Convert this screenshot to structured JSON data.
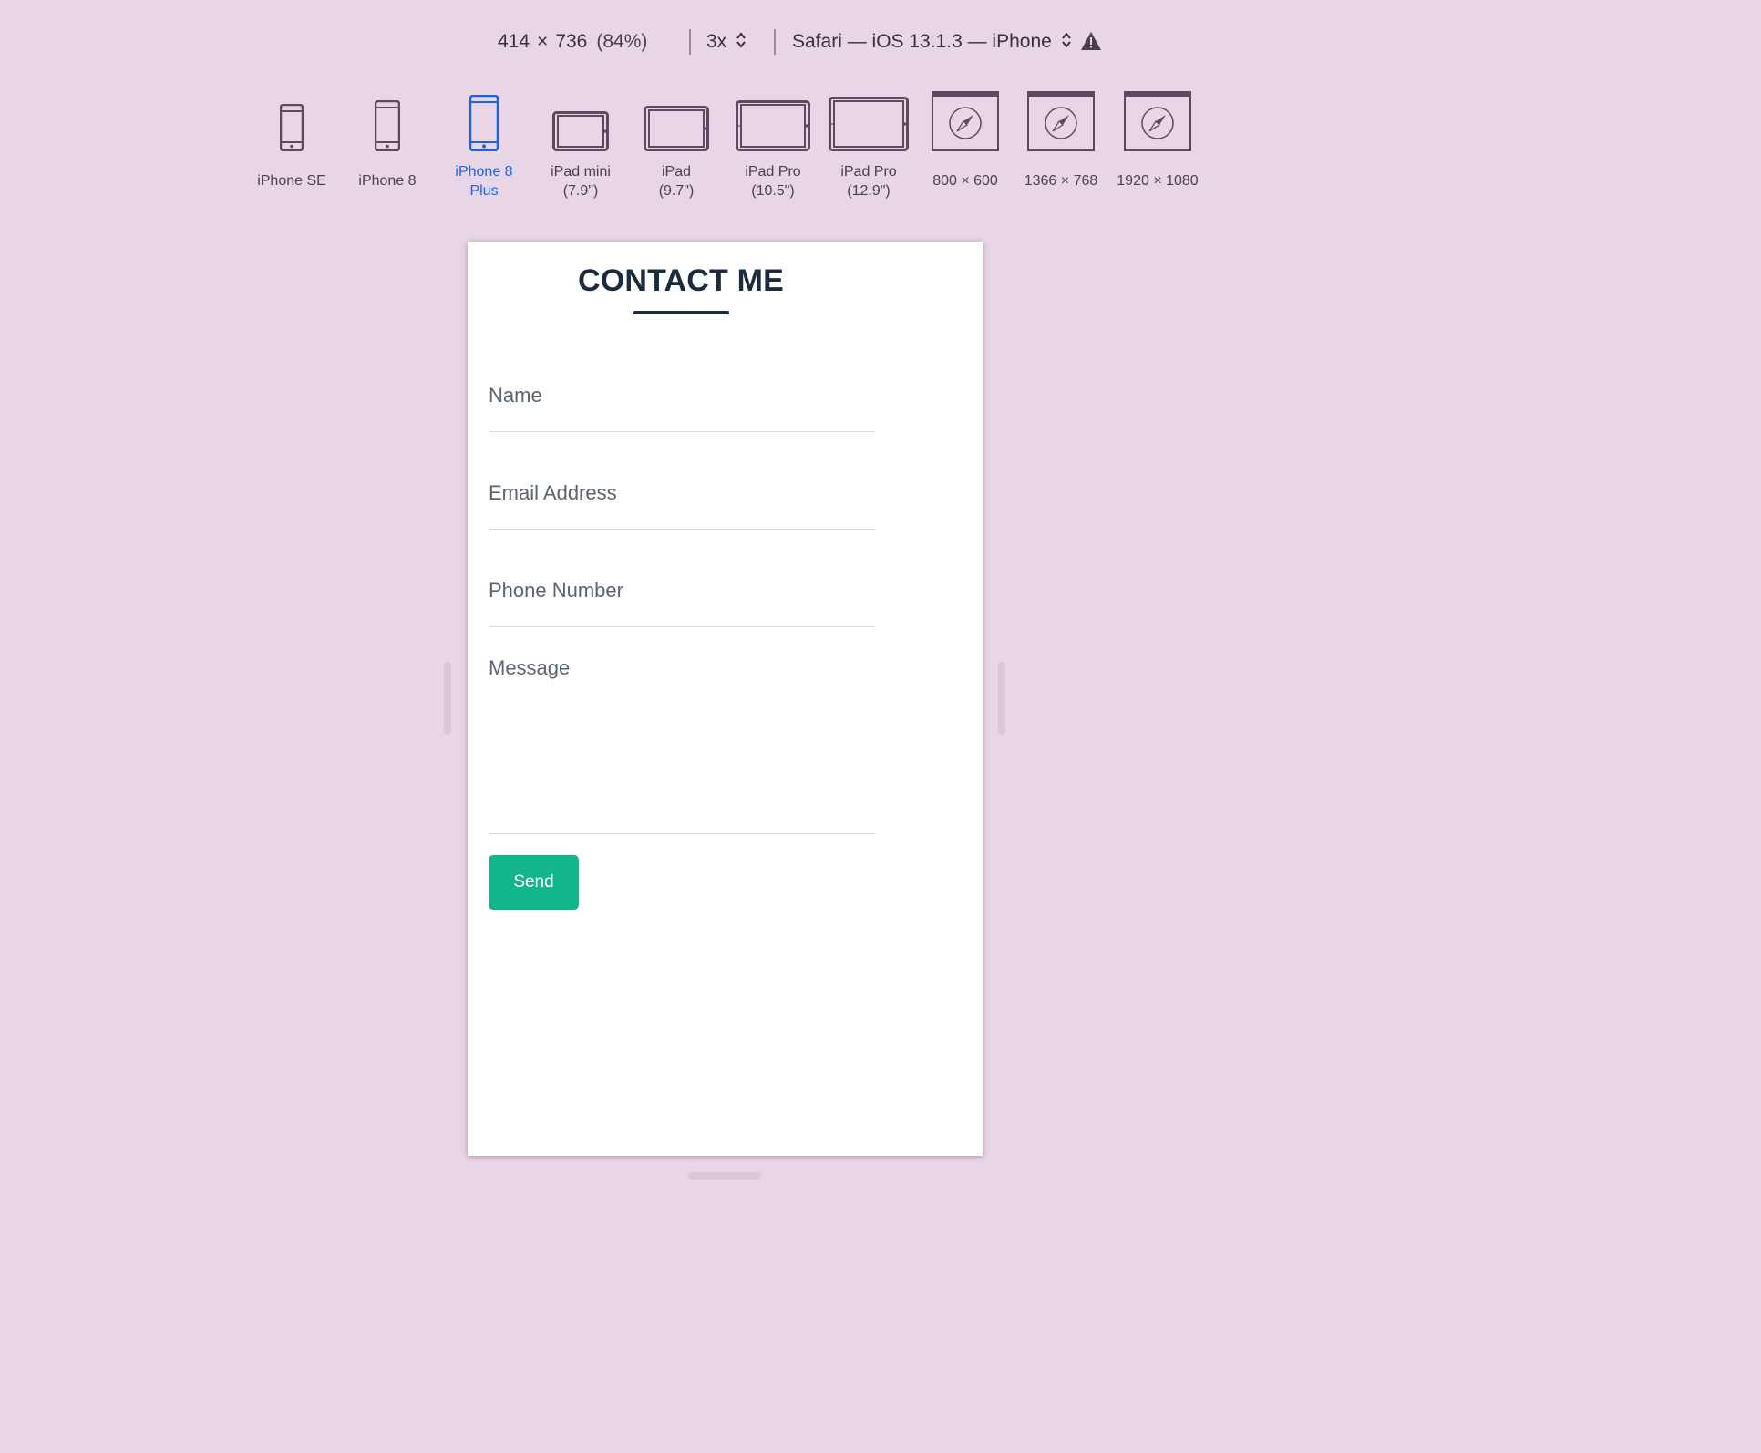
{
  "toolbar": {
    "width": "414",
    "times": "×",
    "height": "736",
    "zoom": "(84%)",
    "scale": "3x",
    "browser": "Safari — iOS 13.1.3 — iPhone"
  },
  "devices": [
    {
      "label": "iPhone SE",
      "icon": "phone-icon"
    },
    {
      "label": "iPhone 8",
      "icon": "phone-icon"
    },
    {
      "label": "iPhone 8\nPlus",
      "icon": "phone-icon",
      "selected": true
    },
    {
      "label": "iPad mini\n(7.9\")",
      "icon": "tablet-icon"
    },
    {
      "label": "iPad\n(9.7\")",
      "icon": "tablet-icon"
    },
    {
      "label": "iPad Pro\n(10.5\")",
      "icon": "tablet-icon"
    },
    {
      "label": "iPad Pro\n(12.9\")",
      "icon": "tablet-icon"
    },
    {
      "label": "800 × 600",
      "icon": "safari-window-icon"
    },
    {
      "label": "1366 × 768",
      "icon": "safari-window-icon"
    },
    {
      "label": "1920 × 1080",
      "icon": "safari-window-icon"
    }
  ],
  "colors": {
    "background": "#e8d5e5",
    "selected": "#1565e6",
    "icon": "#5e4a5e",
    "heading": "#1c2b3c",
    "accent": "#13b58d"
  },
  "page": {
    "title": "CONTACT ME",
    "name_placeholder": "Name",
    "email_placeholder": "Email Address",
    "phone_placeholder": "Phone Number",
    "message_placeholder": "Message",
    "send_label": "Send"
  }
}
